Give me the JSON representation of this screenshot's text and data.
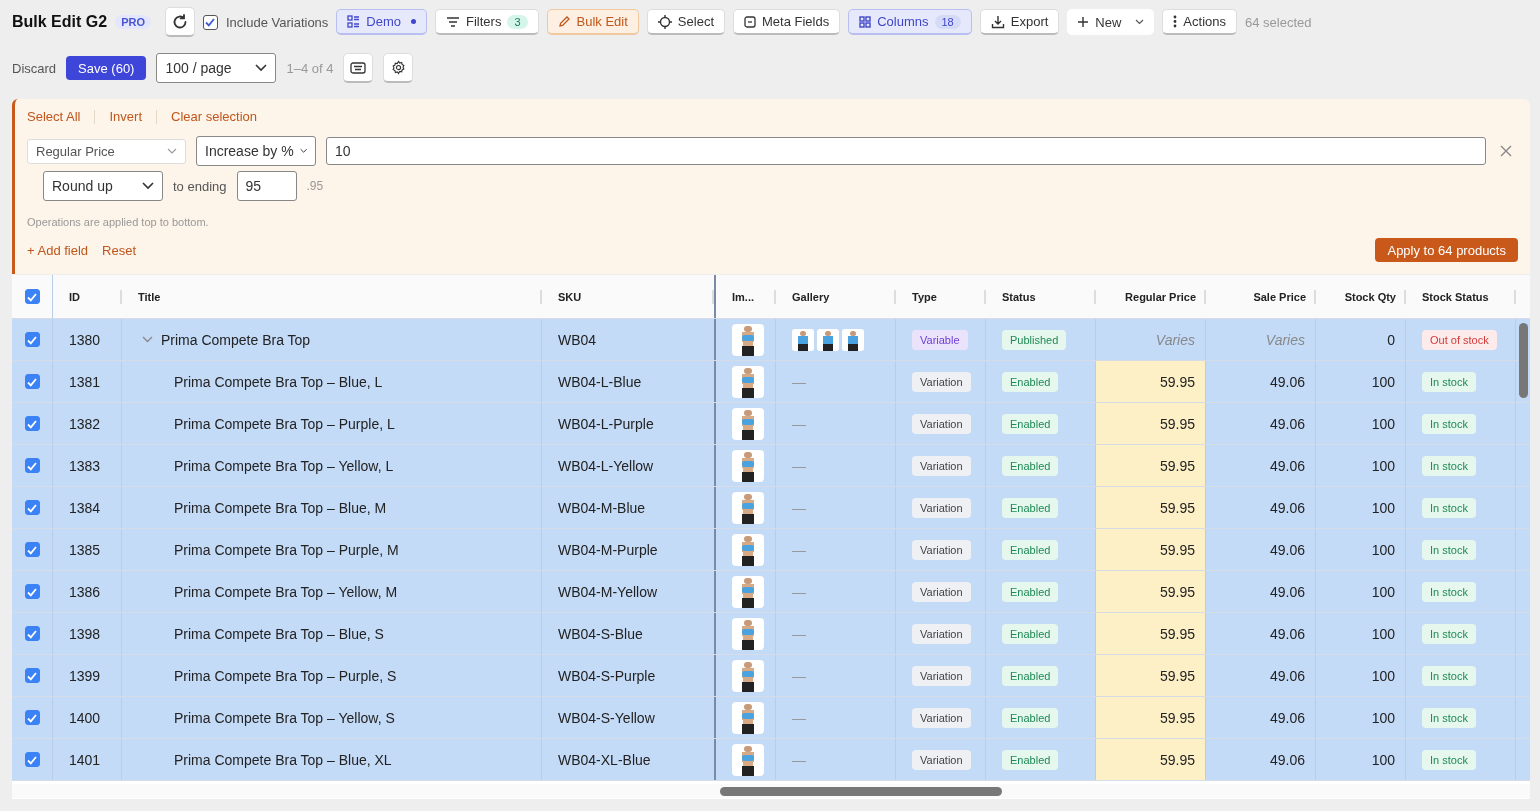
{
  "toolbar": {
    "title": "Bulk Edit G2",
    "badge": "PRO",
    "include_variations": {
      "label": "Include Variations",
      "checked": true
    },
    "demo": {
      "label": "Demo",
      "active": true
    },
    "filters": {
      "label": "Filters",
      "count": "3"
    },
    "bulk_edit": {
      "label": "Bulk Edit",
      "active": true
    },
    "select": {
      "label": "Select"
    },
    "meta_fields": {
      "label": "Meta Fields"
    },
    "columns": {
      "label": "Columns",
      "count": "18",
      "active": true
    },
    "export": {
      "label": "Export"
    },
    "new": {
      "label": "New"
    },
    "actions": {
      "label": "Actions"
    },
    "selection_count": "64 selected"
  },
  "subbar": {
    "discard": "Discard",
    "save": "Save (60)",
    "page_size": "100 / page",
    "range": "1–4 of 4"
  },
  "bulk_panel": {
    "links": [
      "Select All",
      "Invert",
      "Clear selection"
    ],
    "field": "Regular Price",
    "operation": "Increase by %",
    "value": "10",
    "rounding": "Round up",
    "ending_label": "to ending",
    "ending": "95",
    "ending_preview": ".95",
    "note": "Operations are applied top to bottom.",
    "add_field": "+ Add field",
    "reset": "Reset",
    "apply": "Apply to 64 products"
  },
  "table": {
    "all_selected": true,
    "columns": [
      "ID",
      "Title",
      "SKU",
      "Im...",
      "Gallery",
      "Type",
      "Status",
      "Regular Price",
      "Sale Price",
      "Stock Qty",
      "Stock Status"
    ],
    "rows": [
      {
        "kind": "parent",
        "selected": true,
        "expanded": true,
        "id": "1380",
        "title": "Prima Compete Bra Top",
        "sku": "WB04",
        "type": "Variable",
        "status": "Published",
        "regular_price": "Varies",
        "regular_changed": false,
        "sale_price": "Varies",
        "stock_qty": "0",
        "stock_status": "Out of stock",
        "in_stock": false
      },
      {
        "kind": "variation",
        "selected": true,
        "id": "1381",
        "title": "Prima Compete Bra Top – Blue, L",
        "sku": "WB04-L-Blue",
        "gallery": "—",
        "type": "Variation",
        "status": "Enabled",
        "regular_price": "59.95",
        "regular_changed": true,
        "sale_price": "49.06",
        "stock_qty": "100",
        "stock_status": "In stock",
        "in_stock": true
      },
      {
        "kind": "variation",
        "selected": true,
        "id": "1382",
        "title": "Prima Compete Bra Top – Purple, L",
        "sku": "WB04-L-Purple",
        "gallery": "—",
        "type": "Variation",
        "status": "Enabled",
        "regular_price": "59.95",
        "regular_changed": true,
        "sale_price": "49.06",
        "stock_qty": "100",
        "stock_status": "In stock",
        "in_stock": true
      },
      {
        "kind": "variation",
        "selected": true,
        "id": "1383",
        "title": "Prima Compete Bra Top – Yellow, L",
        "sku": "WB04-L-Yellow",
        "gallery": "—",
        "type": "Variation",
        "status": "Enabled",
        "regular_price": "59.95",
        "regular_changed": true,
        "sale_price": "49.06",
        "stock_qty": "100",
        "stock_status": "In stock",
        "in_stock": true
      },
      {
        "kind": "variation",
        "selected": true,
        "id": "1384",
        "title": "Prima Compete Bra Top – Blue, M",
        "sku": "WB04-M-Blue",
        "gallery": "—",
        "type": "Variation",
        "status": "Enabled",
        "regular_price": "59.95",
        "regular_changed": true,
        "sale_price": "49.06",
        "stock_qty": "100",
        "stock_status": "In stock",
        "in_stock": true
      },
      {
        "kind": "variation",
        "selected": true,
        "id": "1385",
        "title": "Prima Compete Bra Top – Purple, M",
        "sku": "WB04-M-Purple",
        "gallery": "—",
        "type": "Variation",
        "status": "Enabled",
        "regular_price": "59.95",
        "regular_changed": true,
        "sale_price": "49.06",
        "stock_qty": "100",
        "stock_status": "In stock",
        "in_stock": true
      },
      {
        "kind": "variation",
        "selected": true,
        "id": "1386",
        "title": "Prima Compete Bra Top – Yellow, M",
        "sku": "WB04-M-Yellow",
        "gallery": "—",
        "type": "Variation",
        "status": "Enabled",
        "regular_price": "59.95",
        "regular_changed": true,
        "sale_price": "49.06",
        "stock_qty": "100",
        "stock_status": "In stock",
        "in_stock": true
      },
      {
        "kind": "variation",
        "selected": true,
        "id": "1398",
        "title": "Prima Compete Bra Top – Blue, S",
        "sku": "WB04-S-Blue",
        "gallery": "—",
        "type": "Variation",
        "status": "Enabled",
        "regular_price": "59.95",
        "regular_changed": true,
        "sale_price": "49.06",
        "stock_qty": "100",
        "stock_status": "In stock",
        "in_stock": true
      },
      {
        "kind": "variation",
        "selected": true,
        "id": "1399",
        "title": "Prima Compete Bra Top – Purple, S",
        "sku": "WB04-S-Purple",
        "gallery": "—",
        "type": "Variation",
        "status": "Enabled",
        "regular_price": "59.95",
        "regular_changed": true,
        "sale_price": "49.06",
        "stock_qty": "100",
        "stock_status": "In stock",
        "in_stock": true
      },
      {
        "kind": "variation",
        "selected": true,
        "id": "1400",
        "title": "Prima Compete Bra Top – Yellow, S",
        "sku": "WB04-S-Yellow",
        "gallery": "—",
        "type": "Variation",
        "status": "Enabled",
        "regular_price": "59.95",
        "regular_changed": true,
        "sale_price": "49.06",
        "stock_qty": "100",
        "stock_status": "In stock",
        "in_stock": true
      },
      {
        "kind": "variation",
        "selected": true,
        "id": "1401",
        "title": "Prima Compete Bra Top – Blue, XL",
        "sku": "WB04-XL-Blue",
        "gallery": "—",
        "type": "Variation",
        "status": "Enabled",
        "regular_price": "59.95",
        "regular_changed": true,
        "sale_price": "49.06",
        "stock_qty": "100",
        "stock_status": "In stock",
        "in_stock": true
      }
    ]
  }
}
